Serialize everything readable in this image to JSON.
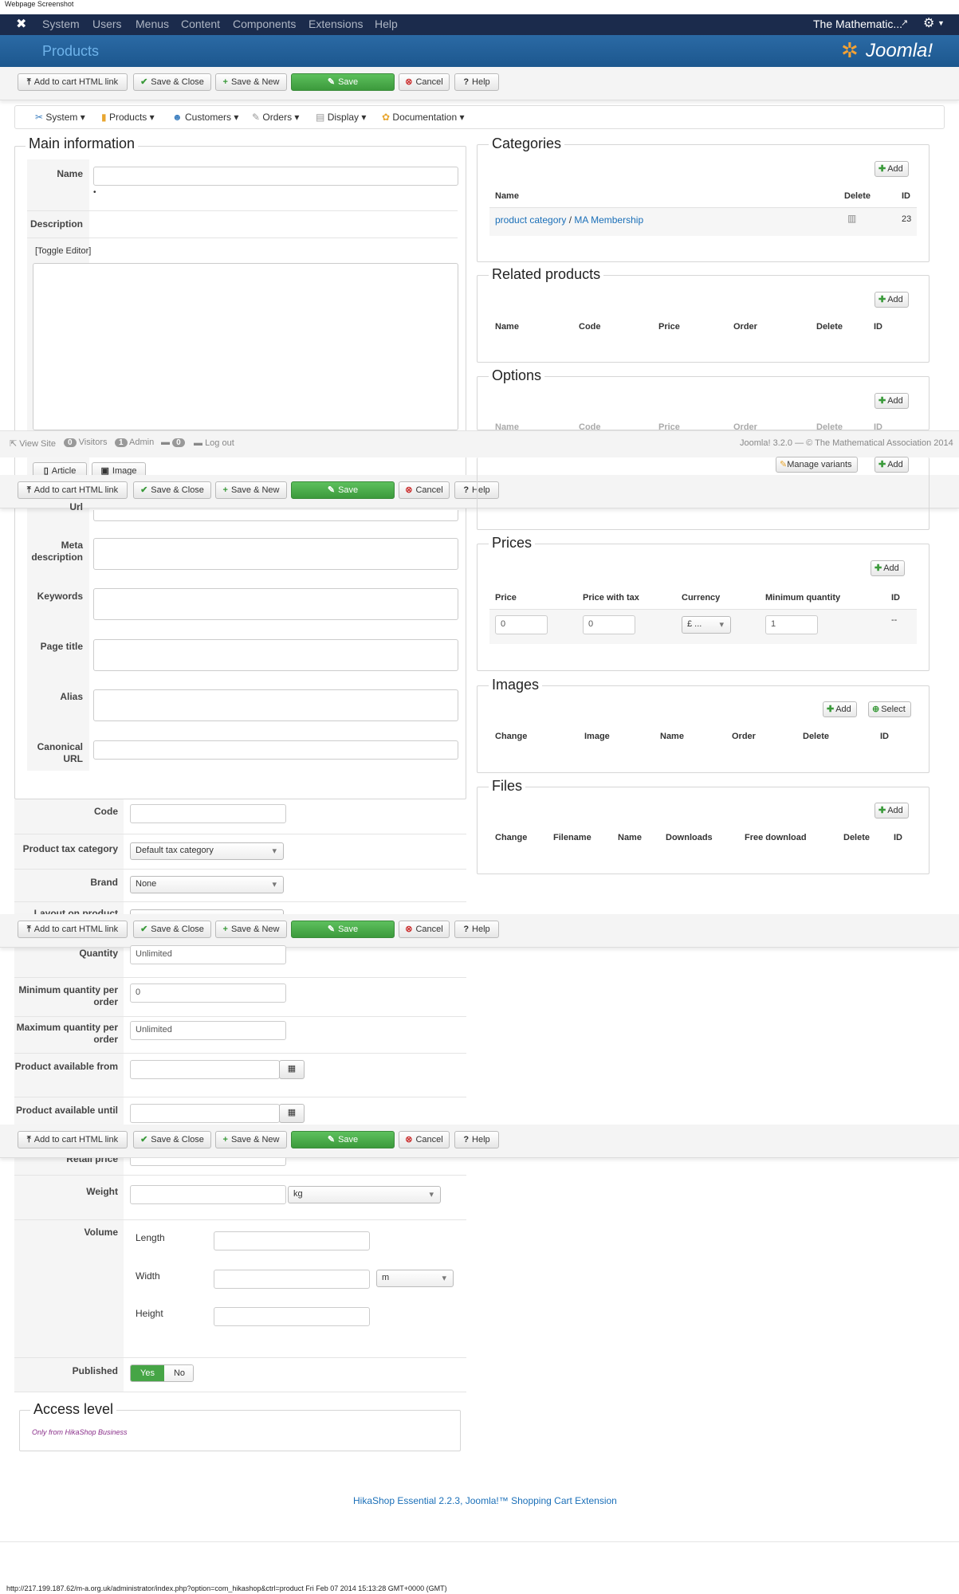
{
  "page_caption": "Webpage Screenshot",
  "topmenu": {
    "items": [
      "System",
      "Users",
      "Menus",
      "Content",
      "Components",
      "Extensions",
      "Help"
    ],
    "site_name": "The Mathematic..."
  },
  "header": {
    "title": "Products",
    "logo": "Joomla!"
  },
  "toolbar": {
    "add_to_cart": "Add to cart HTML link",
    "save_close": "Save & Close",
    "save_new": "Save & New",
    "save": "Save",
    "cancel": "Cancel",
    "help": "Help"
  },
  "navmenu": [
    "System",
    "Products",
    "Customers",
    "Orders",
    "Display",
    "Documentation"
  ],
  "main_info": {
    "legend": "Main information",
    "name_label": "Name",
    "description_label": "Description",
    "toggle_editor": "[Toggle Editor]",
    "article_btn": "Article",
    "image_btn": "Image"
  },
  "meta": {
    "url_label": "Url",
    "meta_desc_label": "Meta description",
    "keywords_label": "Keywords",
    "page_title_label": "Page title",
    "alias_label": "Alias",
    "canonical_label": "Canonical URL"
  },
  "footerbar": {
    "view_site": "View Site",
    "visitors_count": "0",
    "visitors": "Visitors",
    "admin_count": "1",
    "admin": "Admin",
    "msg_count": "0",
    "logout": "Log out",
    "version": "Joomla! 3.2.0 — © The Mathematical Association 2014"
  },
  "categories": {
    "legend": "Categories",
    "add": "Add",
    "headers": [
      "Name",
      "Delete",
      "ID"
    ],
    "row_cat1": "product category",
    "row_sep": "/",
    "row_cat2": "MA Membership",
    "row_id": "23"
  },
  "related": {
    "legend": "Related products",
    "add": "Add",
    "headers": [
      "Name",
      "Code",
      "Price",
      "Order",
      "Delete",
      "ID"
    ]
  },
  "options": {
    "legend": "Options",
    "add": "Add",
    "headers": [
      "Name",
      "Code",
      "Price",
      "Order",
      "Delete",
      "ID"
    ],
    "manage_variants": "Manage variants"
  },
  "prices": {
    "legend": "Prices",
    "add": "Add",
    "headers": [
      "Price",
      "Price with tax",
      "Currency",
      "Minimum quantity",
      "ID"
    ],
    "price": "0",
    "price_tax": "0",
    "currency": "£ ...",
    "min_qty": "1",
    "id": "--"
  },
  "images": {
    "legend": "Images",
    "add": "Add",
    "select": "Select",
    "headers": [
      "Change",
      "Image",
      "Name",
      "Order",
      "Delete",
      "ID"
    ]
  },
  "files": {
    "legend": "Files",
    "add": "Add",
    "headers": [
      "Change",
      "Filename",
      "Name",
      "Downloads",
      "Free download",
      "Delete",
      "ID"
    ]
  },
  "details": {
    "code_label": "Code",
    "tax_label": "Product tax category",
    "tax_value": "Default tax category",
    "brand_label": "Brand",
    "brand_value": "None",
    "layout_label": "Layout on product",
    "quantity_label": "Quantity",
    "quantity_value": "Unlimited",
    "min_label": "Minimum quantity per order",
    "min_value": "0",
    "max_label": "Maximum quantity per order",
    "max_value": "Unlimited",
    "from_label": "Product available from",
    "until_label": "Product available until",
    "retail_label": "Retail price",
    "weight_label": "Weight",
    "weight_unit": "kg",
    "volume_label": "Volume",
    "length_label": "Length",
    "width_label": "Width",
    "height_label": "Height",
    "volume_unit": "m",
    "published_label": "Published",
    "yes": "Yes",
    "no": "No"
  },
  "access": {
    "legend": "Access level",
    "note": "Only from HikaShop Business"
  },
  "credit": "HikaShop Essential 2.2.3, Joomla!™ Shopping Cart Extension",
  "status_url": "http://217.199.187.62/m-a.org.uk/administrator/index.php?option=com_hikashop&ctrl=product Fri Feb 07 2014 15:13:28 GMT+0000 (GMT)"
}
